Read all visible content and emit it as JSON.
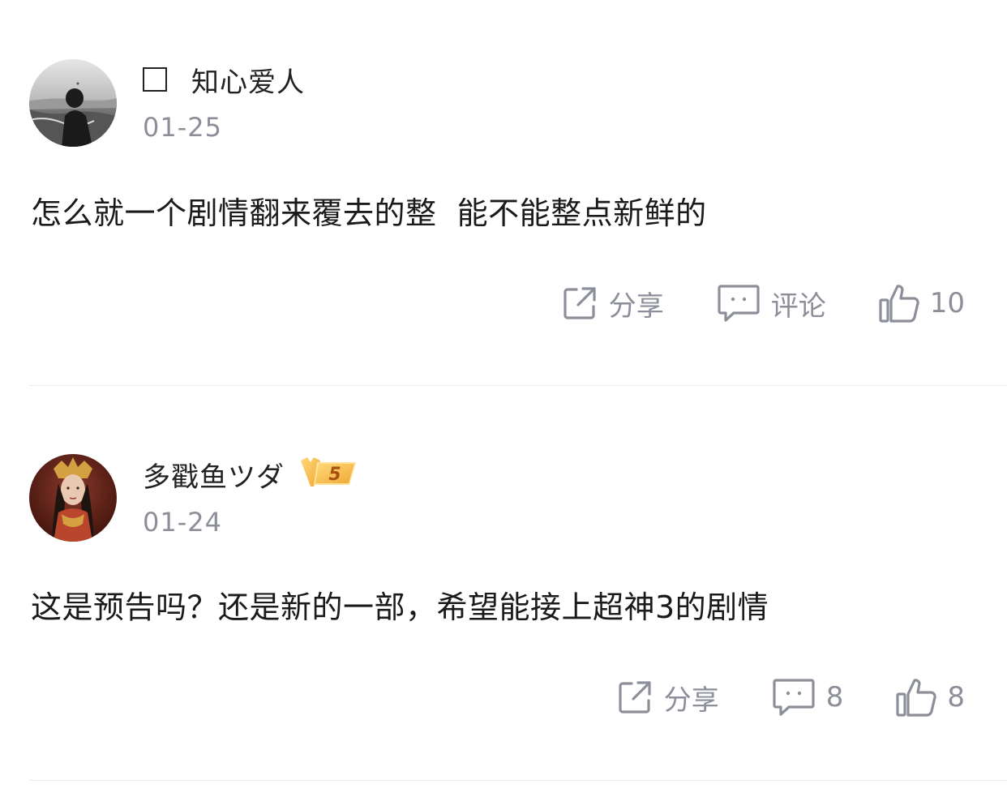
{
  "comments": [
    {
      "username": "知心爱人",
      "date": "01-25",
      "content": "怎么就一个剧情翻来覆去的整  能不能整点新鲜的",
      "actions": {
        "share": "分享",
        "comment": "评论",
        "like": "10"
      }
    },
    {
      "username": "多戳鱼ツダ",
      "vip_level": "5",
      "date": "01-24",
      "content": "这是预告吗？还是新的一部，希望能接上超神3的剧情",
      "actions": {
        "share": "分享",
        "comment": "8",
        "like": "8"
      }
    }
  ],
  "colors": {
    "text": "#1a1a1a",
    "muted": "#8c8f99",
    "divider": "#ebebeb",
    "vip_gold": "#f5c24a"
  },
  "icons": [
    "share-icon",
    "comment-icon",
    "thumbs-up-icon",
    "vip-badge-icon"
  ]
}
